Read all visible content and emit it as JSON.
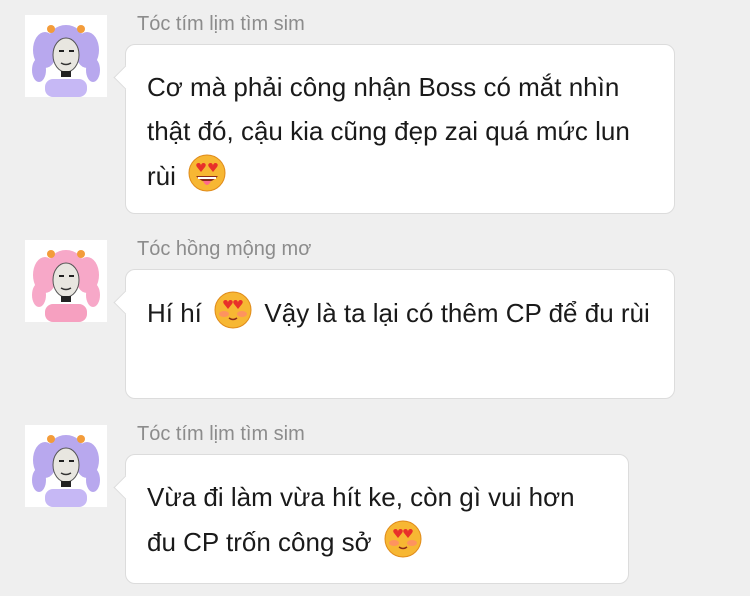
{
  "messages": [
    {
      "sender": "Tóc tím lịm tìm sim",
      "avatar_hair": "#b8a8ee",
      "avatar_shirt": "#c6b8f5",
      "text_before": "Cơ mà phải công nhận Boss có mắt nhìn thật  đó, cậu kia cũng đẹp zai quá mức lun rùi",
      "emoji": "heart-eyes-drooling-emoji",
      "text_after": ""
    },
    {
      "sender": "Tóc hồng mộng mơ",
      "avatar_hair": "#f7a8c8",
      "avatar_shirt": "#f6a0c0",
      "text_before": "Hí hí",
      "emoji": "blushing-heart-eyes-emoji",
      "text_after": "Vậy là ta lại có thêm CP để đu rùi"
    },
    {
      "sender": "Tóc tím lịm tìm sim",
      "avatar_hair": "#b8a8ee",
      "avatar_shirt": "#c6b8f5",
      "text_before": "Vừa đi làm vừa hít ke, còn gì vui hơn đu CP trốn công sở",
      "emoji": "blushing-heart-eyes-emoji",
      "text_after": ""
    }
  ]
}
